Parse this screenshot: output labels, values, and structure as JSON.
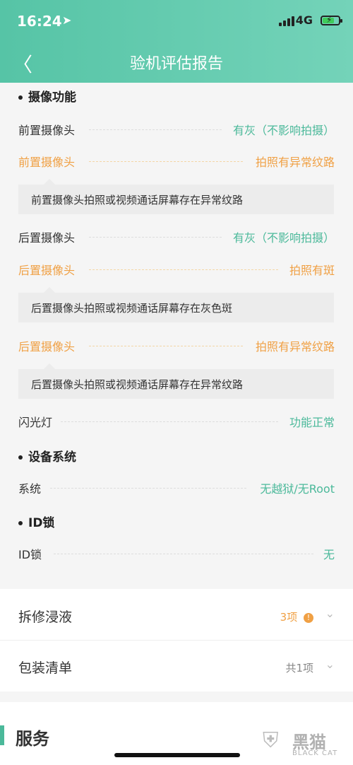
{
  "status_bar": {
    "time": "16:24",
    "network": "4G"
  },
  "nav": {
    "back_icon": "chevron-left-icon",
    "title": "验机评估报告"
  },
  "sections": {
    "camera": {
      "title": "摄像功能",
      "front_gray": {
        "label": "前置摄像头",
        "value": "有灰（不影响拍摄）"
      },
      "front_pattern": {
        "label": "前置摄像头",
        "value": "拍照有异常纹路",
        "note": "前置摄像头拍照或视频通话屏幕存在异常纹路"
      },
      "rear_gray": {
        "label": "后置摄像头",
        "value": "有灰（不影响拍摄）"
      },
      "rear_spot": {
        "label": "后置摄像头",
        "value": "拍照有斑",
        "note": "后置摄像头拍照或视频通话屏幕存在灰色斑"
      },
      "rear_pattern": {
        "label": "后置摄像头",
        "value": "拍照有异常纹路",
        "note": "后置摄像头拍照或视频通话屏幕存在异常纹路"
      },
      "flash": {
        "label": "闪光灯",
        "value": "功能正常"
      }
    },
    "system": {
      "title": "设备系统",
      "row": {
        "label": "系统",
        "value": "无越狱/无Root"
      }
    },
    "idlock": {
      "title": "ID锁",
      "row": {
        "label": "ID锁",
        "value": "无"
      }
    }
  },
  "panels": {
    "repair": {
      "label": "拆修浸液",
      "count": "3项",
      "alert": "!"
    },
    "packing": {
      "label": "包装清单",
      "count": "共1项"
    }
  },
  "service": {
    "title": "服务"
  },
  "watermark": {
    "text": "黑猫",
    "sub": "BLACK CAT"
  },
  "colors": {
    "accent": "#4bb99a",
    "warning": "#f0a044",
    "header": "#5cc8aa"
  }
}
